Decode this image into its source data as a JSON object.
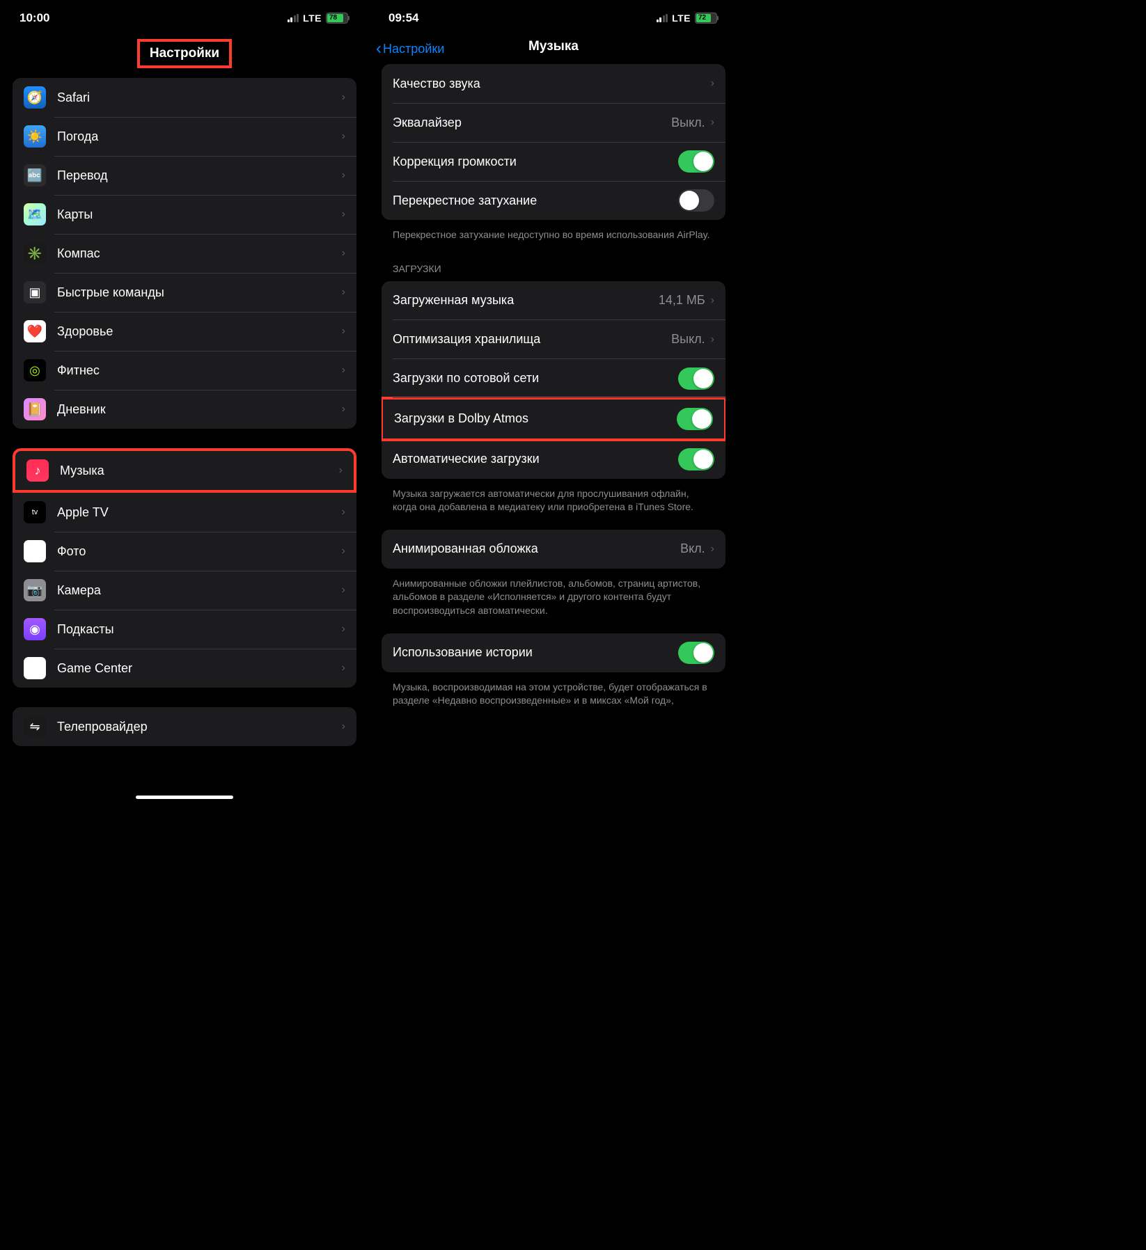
{
  "left": {
    "status": {
      "time": "10:00",
      "lte": "LTE",
      "battery": "78"
    },
    "title": "Настройки",
    "group1": [
      {
        "label": "Safari",
        "icon_name": "safari-icon",
        "icon_class": "ic-safari",
        "glyph": "🧭"
      },
      {
        "label": "Погода",
        "icon_name": "weather-icon",
        "icon_class": "ic-weather",
        "glyph": "☀️"
      },
      {
        "label": "Перевод",
        "icon_name": "translate-icon",
        "icon_class": "ic-translate",
        "glyph": "🔤"
      },
      {
        "label": "Карты",
        "icon_name": "maps-icon",
        "icon_class": "ic-maps",
        "glyph": "🗺️"
      },
      {
        "label": "Компас",
        "icon_name": "compass-icon",
        "icon_class": "ic-compass",
        "glyph": "✳️"
      },
      {
        "label": "Быстрые команды",
        "icon_name": "shortcuts-icon",
        "icon_class": "ic-shortcuts",
        "glyph": "▣"
      },
      {
        "label": "Здоровье",
        "icon_name": "health-icon",
        "icon_class": "ic-health",
        "glyph": "❤️"
      },
      {
        "label": "Фитнес",
        "icon_name": "fitness-icon",
        "icon_class": "ic-fitness",
        "glyph": "◎"
      },
      {
        "label": "Дневник",
        "icon_name": "journal-icon",
        "icon_class": "ic-journal",
        "glyph": "📔"
      }
    ],
    "group2": [
      {
        "label": "Музыка",
        "icon_name": "music-icon",
        "icon_class": "ic-music",
        "glyph": "♪",
        "highlighted": true
      },
      {
        "label": "Apple TV",
        "icon_name": "tv-icon",
        "icon_class": "ic-tv",
        "glyph": "tv"
      },
      {
        "label": "Фото",
        "icon_name": "photos-icon",
        "icon_class": "ic-photos",
        "glyph": "❀"
      },
      {
        "label": "Камера",
        "icon_name": "camera-icon",
        "icon_class": "ic-camera",
        "glyph": "📷"
      },
      {
        "label": "Подкасты",
        "icon_name": "podcasts-icon",
        "icon_class": "ic-podcasts",
        "glyph": "◉"
      },
      {
        "label": "Game Center",
        "icon_name": "gamecenter-icon",
        "icon_class": "ic-gamecenter",
        "glyph": "●●"
      }
    ],
    "group3": [
      {
        "label": "Телепровайдер",
        "icon_name": "teleprovider-icon",
        "icon_class": "ic-teleprovider",
        "glyph": "⇋"
      }
    ]
  },
  "right": {
    "status": {
      "time": "09:54",
      "lte": "LTE",
      "battery": "72"
    },
    "back_label": "Настройки",
    "title": "Музыка",
    "groupA": [
      {
        "label": "Качество звука",
        "type": "nav"
      },
      {
        "label": "Эквалайзер",
        "type": "nav",
        "value": "Выкл."
      },
      {
        "label": "Коррекция громкости",
        "type": "toggle",
        "on": true
      },
      {
        "label": "Перекрестное затухание",
        "type": "toggle",
        "on": false
      }
    ],
    "footerA": "Перекрестное затухание недоступно во время использования AirPlay.",
    "sectionB_header": "ЗАГРУЗКИ",
    "groupB": [
      {
        "label": "Загруженная музыка",
        "type": "nav",
        "value": "14,1 МБ"
      },
      {
        "label": "Оптимизация хранилища",
        "type": "nav",
        "value": "Выкл."
      },
      {
        "label": "Загрузки по сотовой сети",
        "type": "toggle",
        "on": true
      },
      {
        "label": "Загрузки в Dolby Atmos",
        "type": "toggle",
        "on": true,
        "highlighted": true
      },
      {
        "label": "Автоматические загрузки",
        "type": "toggle",
        "on": true
      }
    ],
    "footerB": "Музыка загружается автоматически для прослушивания офлайн, когда она добавлена в медиатеку или приобретена в iTunes Store.",
    "groupC": [
      {
        "label": "Анимированная обложка",
        "type": "nav",
        "value": "Вкл."
      }
    ],
    "footerC": "Анимированные обложки плейлистов, альбомов, страниц артистов, альбомов в разделе «Исполняется» и другого контента будут воспроизводиться автоматически.",
    "groupD": [
      {
        "label": "Использование истории",
        "type": "toggle",
        "on": true
      }
    ],
    "footerD": "Музыка, воспроизводимая на этом устройстве, будет отображаться в разделе «Недавно воспроизведенные» и в миксах «Мой год»,"
  }
}
